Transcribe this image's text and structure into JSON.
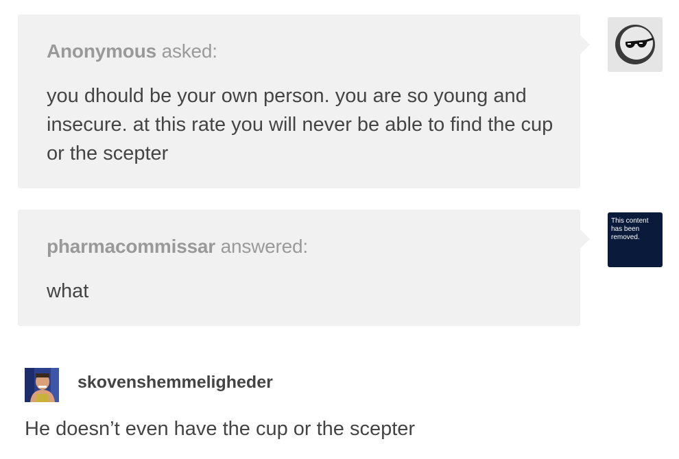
{
  "ask": {
    "asker": "Anonymous",
    "verb": "asked:",
    "text": "you dhould be your own person. you are so young and insecure. at this rate you will never be able to find the cup or the scepter"
  },
  "answer": {
    "answerer": "pharmacommissar",
    "verb": "answered:",
    "text": "what",
    "avatar_text": "This content has been removed."
  },
  "reblog": {
    "username": "skovenshemmeligheder",
    "text": "He doesn’t even have the cup or the scepter"
  },
  "icons": {
    "anon_avatar": "sunglasses-moon-icon",
    "user_avatar": "user-photo-avatar"
  },
  "colors": {
    "bubble": "#f1f1f1",
    "removed_avatar_bg": "#0a1a3a",
    "text": "#444444",
    "muted": "#999999"
  }
}
